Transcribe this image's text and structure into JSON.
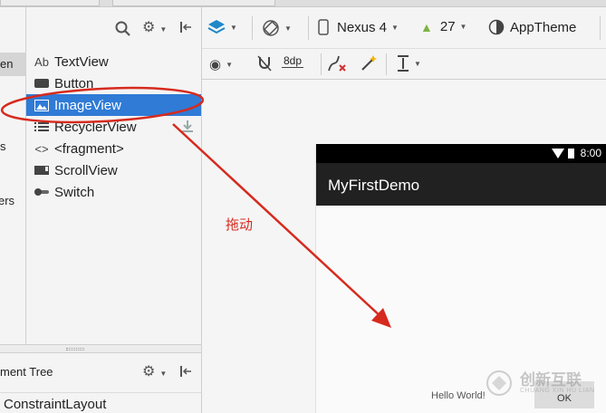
{
  "categories": [
    {
      "label": "en",
      "selected": true
    },
    {
      "label": "s",
      "selected": false
    },
    {
      "label": "ers",
      "selected": false
    }
  ],
  "palette": {
    "items": [
      {
        "label": "TextView",
        "icon": "text-view-icon",
        "icon_text": "Ab",
        "selected": false
      },
      {
        "label": "Button",
        "icon": "button-icon",
        "icon_text": "",
        "selected": false
      },
      {
        "label": "ImageView",
        "icon": "image-view-icon",
        "icon_text": "",
        "selected": true
      },
      {
        "label": "RecyclerView",
        "icon": "recycler-view-icon",
        "icon_text": "",
        "selected": false
      },
      {
        "label": "<fragment>",
        "icon": "fragment-icon",
        "icon_text": "<>",
        "selected": false
      },
      {
        "label": "ScrollView",
        "icon": "scroll-view-icon",
        "icon_text": "",
        "selected": false
      },
      {
        "label": "Switch",
        "icon": "switch-icon",
        "icon_text": "",
        "selected": false
      }
    ]
  },
  "component_tree": {
    "title": "ment Tree",
    "root": "ConstraintLayout"
  },
  "toolbar": {
    "device": "Nexus 4",
    "api_level": "27",
    "theme": "AppTheme",
    "margin": "8dp"
  },
  "preview": {
    "status_time": "8:00",
    "app_title": "MyFirstDemo",
    "hello_text": "Hello World!",
    "ok_button": "OK"
  },
  "annotation": {
    "label": "拖动",
    "color": "#d62a1e"
  },
  "watermark": {
    "text": "创新互联",
    "subtext": "CHUANG XIN HU LIAN"
  },
  "colors": {
    "selection": "#2f7bd6",
    "appbar": "#212121",
    "statusbar": "#000000"
  }
}
